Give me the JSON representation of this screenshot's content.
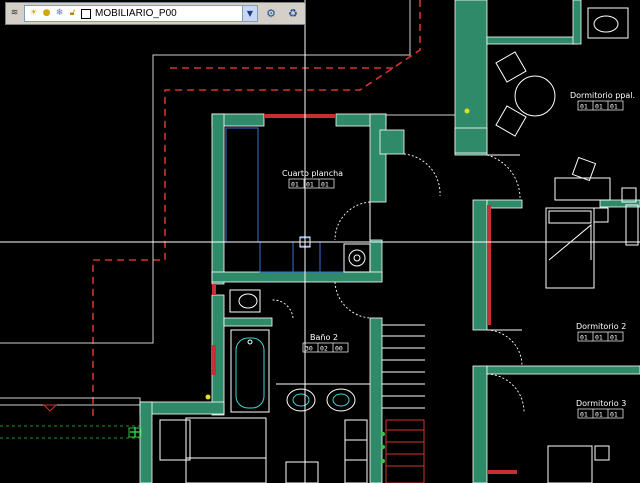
{
  "toolbar": {
    "layer_name": "MOBILIARIO_P00",
    "icons": [
      "layers-icon",
      "lightbulb-icon",
      "sun-icon",
      "freeze-icon",
      "lock-icon",
      "color-swatch-icon"
    ],
    "buttons": [
      "make-current-layer-icon",
      "previous-layer-icon"
    ]
  },
  "rooms": [
    {
      "name": "Cuarto plancha",
      "tag": [
        "01",
        "01",
        "01"
      ]
    },
    {
      "name": "Dormitorio ppal.",
      "tag": [
        "01",
        "01",
        "01"
      ]
    },
    {
      "name": "Baño 2",
      "tag": [
        "30",
        "02",
        "00"
      ]
    },
    {
      "name": "Dormitorio 2",
      "tag": [
        "01",
        "01",
        "01"
      ]
    },
    {
      "name": "Dormitorio 3",
      "tag": [
        "01",
        "01",
        "01"
      ]
    }
  ],
  "colors": {
    "background": "#000000",
    "wall": "#2f8a6a",
    "wall_outline": "#ffffff",
    "property_line": "#d43232",
    "fixture": "#ffffff",
    "furniture_blue": "#3b6fd8",
    "crosshair": "#ffffff",
    "cursor_green": "#2ecc40"
  }
}
